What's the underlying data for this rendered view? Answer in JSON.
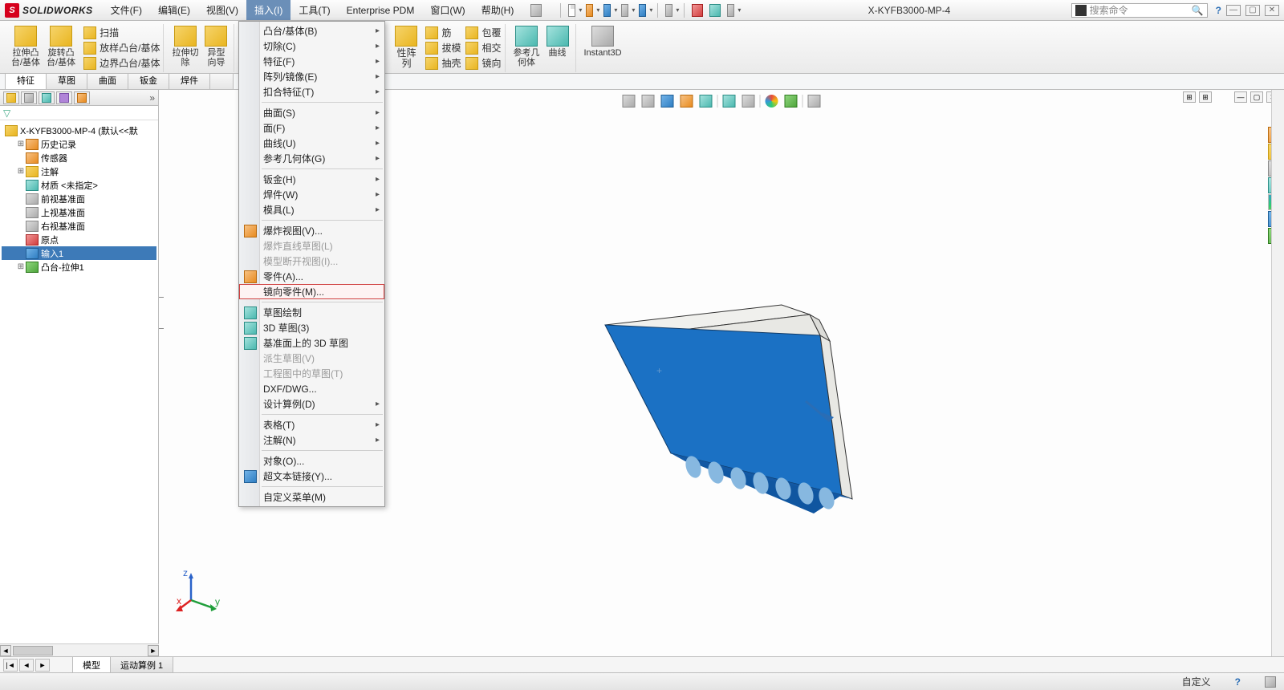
{
  "app": {
    "name": "SOLIDWORKS",
    "doc_title": "X-KYFB3000-MP-4",
    "search_placeholder": "搜索命令"
  },
  "menubar": {
    "items": [
      "文件(F)",
      "编辑(E)",
      "视图(V)",
      "插入(I)",
      "工具(T)",
      "Enterprise PDM",
      "窗口(W)",
      "帮助(H)"
    ],
    "active_index": 3
  },
  "ribbon": {
    "g1": {
      "btn1": "拉伸凸\n台/基体",
      "btn2": "旋转凸\n台/基体",
      "sub": [
        "扫描",
        "放样凸台/基体",
        "边界凸台/基体"
      ]
    },
    "g2": {
      "btn1": "拉伸切\n除",
      "btn2": "异型\n向导"
    },
    "g3_right": {
      "col1": [
        "性阵",
        "列"
      ],
      "col2": [
        "筋",
        "抽壳"
      ],
      "col3": [
        "包覆",
        "镜向"
      ],
      "btn_draft": "拔模",
      "btn_intersect": "相交"
    },
    "g4": {
      "btn1": "参考几\n何体",
      "btn2": "曲线"
    },
    "g5": {
      "btn1": "Instant3D"
    }
  },
  "cmdtabs": {
    "items": [
      "特征",
      "草图",
      "曲面",
      "钣金",
      "焊件"
    ],
    "active_index": 0
  },
  "tree": {
    "root": "X-KYFB3000-MP-4  (默认<<默",
    "items": [
      {
        "label": "历史记录",
        "exp": "+",
        "icon": "ic-orange"
      },
      {
        "label": "传感器",
        "exp": "",
        "icon": "ic-orange"
      },
      {
        "label": "注解",
        "exp": "+",
        "icon": "ic-yellow"
      },
      {
        "label": "材质 <未指定>",
        "exp": "",
        "icon": "ic-teal"
      },
      {
        "label": "前视基准面",
        "exp": "",
        "icon": "ic-gray"
      },
      {
        "label": "上视基准面",
        "exp": "",
        "icon": "ic-gray"
      },
      {
        "label": "右视基准面",
        "exp": "",
        "icon": "ic-gray"
      },
      {
        "label": "原点",
        "exp": "",
        "icon": "ic-red"
      },
      {
        "label": "输入1",
        "exp": "",
        "icon": "ic-blue",
        "selected": true
      },
      {
        "label": "凸台-拉伸1",
        "exp": "+",
        "icon": "ic-green"
      }
    ]
  },
  "dropdown": {
    "sections": [
      [
        {
          "l": "凸台/基体(B)",
          "sub": true
        },
        {
          "l": "切除(C)",
          "sub": true
        },
        {
          "l": "特征(F)",
          "sub": true
        },
        {
          "l": "阵列/镜像(E)",
          "sub": true
        },
        {
          "l": "扣合特征(T)",
          "sub": true
        }
      ],
      [
        {
          "l": "曲面(S)",
          "sub": true
        },
        {
          "l": "面(F)",
          "sub": true
        },
        {
          "l": "曲线(U)",
          "sub": true
        },
        {
          "l": "参考几何体(G)",
          "sub": true
        }
      ],
      [
        {
          "l": "钣金(H)",
          "sub": true
        },
        {
          "l": "焊件(W)",
          "sub": true
        },
        {
          "l": "模具(L)",
          "sub": true
        }
      ],
      [
        {
          "l": "爆炸视图(V)...",
          "icon": "ic-orange"
        },
        {
          "l": "爆炸直线草图(L)",
          "disabled": true
        },
        {
          "l": "模型断开视图(I)...",
          "disabled": true
        },
        {
          "l": "零件(A)...",
          "icon": "ic-orange"
        },
        {
          "l": "镜向零件(M)...",
          "highlighted": true
        }
      ],
      [
        {
          "l": "草图绘制",
          "icon": "ic-teal"
        },
        {
          "l": "3D 草图(3)",
          "icon": "ic-teal"
        },
        {
          "l": "基准面上的 3D 草图",
          "icon": "ic-teal"
        },
        {
          "l": "派生草图(V)",
          "disabled": true
        },
        {
          "l": "工程图中的草图(T)",
          "disabled": true
        },
        {
          "l": "DXF/DWG..."
        },
        {
          "l": "设计算例(D)",
          "sub": true
        }
      ],
      [
        {
          "l": "表格(T)",
          "sub": true
        },
        {
          "l": "注解(N)",
          "sub": true
        }
      ],
      [
        {
          "l": "对象(O)..."
        },
        {
          "l": "超文本链接(Y)...",
          "icon": "ic-blue"
        }
      ],
      [
        {
          "l": "自定义菜单(M)"
        }
      ]
    ]
  },
  "bottom_tabs": {
    "items": [
      "模型",
      "运动算例 1"
    ],
    "active_index": 0
  },
  "statusbar": {
    "right": "自定义"
  }
}
